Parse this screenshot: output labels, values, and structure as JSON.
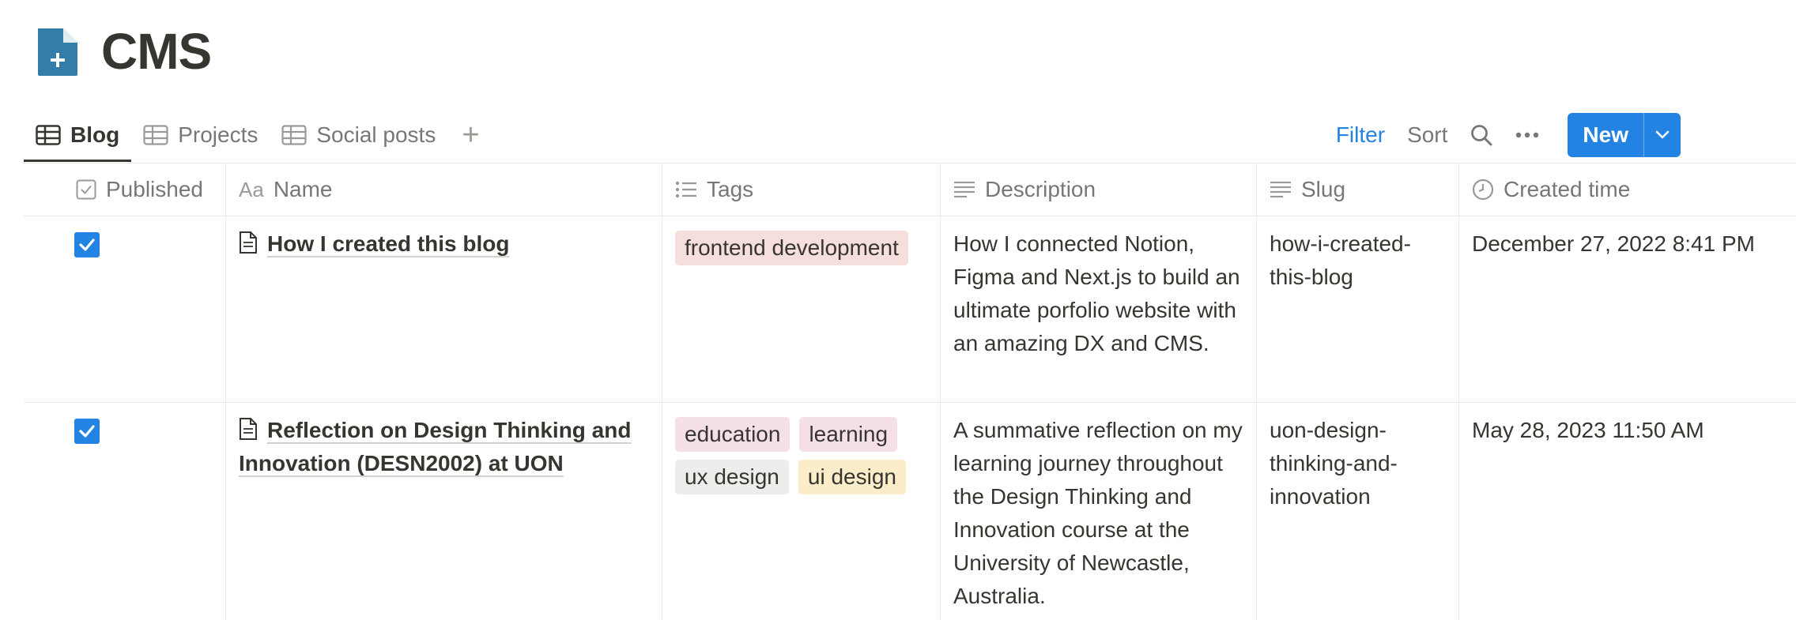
{
  "page": {
    "title": "CMS"
  },
  "views": {
    "tabs": [
      {
        "label": "Blog",
        "active": true
      },
      {
        "label": "Projects",
        "active": false
      },
      {
        "label": "Social posts",
        "active": false
      }
    ],
    "add_symbol": "+"
  },
  "toolbar": {
    "filter_label": "Filter",
    "sort_label": "Sort",
    "new_label": "New"
  },
  "columns": {
    "published": "Published",
    "name_prefix": "Aa",
    "name": "Name",
    "tags": "Tags",
    "description": "Description",
    "slug": "Slug",
    "created_time": "Created time"
  },
  "rows": [
    {
      "published": true,
      "name": "How I created this blog",
      "tags": [
        {
          "label": "frontend development",
          "color": "#f6dedc"
        }
      ],
      "description": "How I connected Notion, Figma and Next.js to build an ultimate porfolio website with an amazing DX and CMS.",
      "slug": "how-i-created-this-blog",
      "created_time": "December 27, 2022 8:41 PM"
    },
    {
      "published": true,
      "name": "Reflection on Design Thinking and Innovation (DESN2002) at UON",
      "tags": [
        {
          "label": "education",
          "color": "#f5e0e9"
        },
        {
          "label": "learning",
          "color": "#f5e0e9"
        },
        {
          "label": "ux design",
          "color": "#ededeb"
        },
        {
          "label": "ui design",
          "color": "#fbecca"
        }
      ],
      "description": "A summative reflection on my learning journey throughout the Design Thinking and Innovation course at the University of Newcastle, Australia.",
      "slug": "uon-design-thinking-and-innovation",
      "created_time": "May 28, 2023 11:50 AM"
    }
  ],
  "colors": {
    "accent": "#2383e2",
    "page_icon": "#337ea9",
    "text": "#37352f",
    "muted": "#787774"
  }
}
